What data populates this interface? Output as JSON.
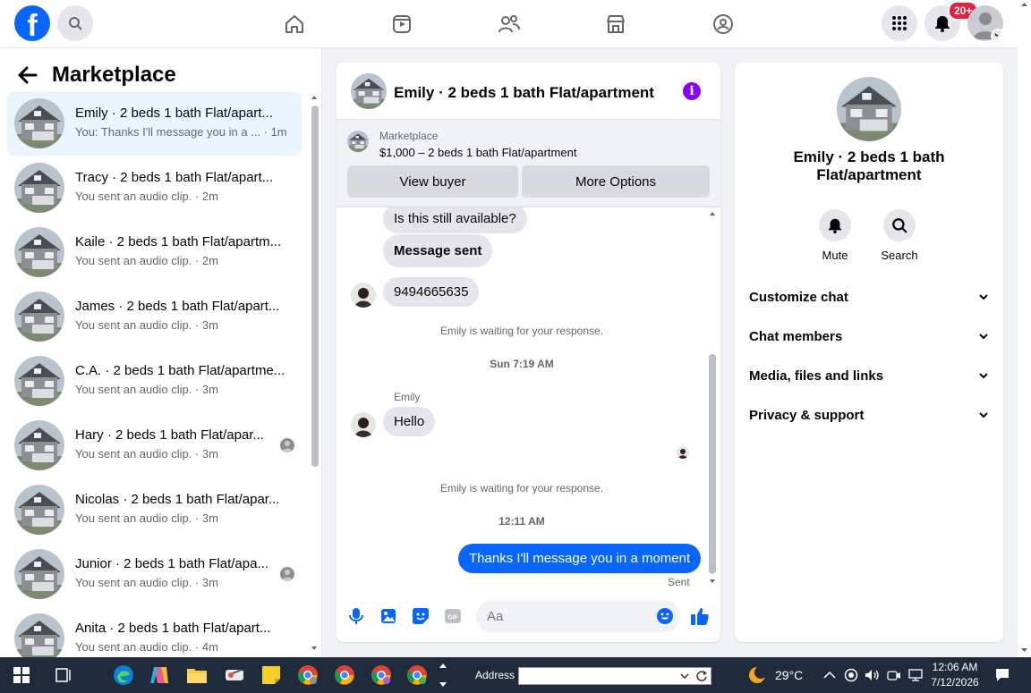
{
  "topbar": {
    "logo_letter": "f",
    "notifications_badge": "20+",
    "icons": [
      "facebook-logo",
      "search-icon",
      "home-icon",
      "video-icon",
      "friends-icon",
      "marketplace-icon",
      "groups-icon",
      "menu-grid-icon",
      "bell-icon",
      "profile-avatar"
    ]
  },
  "left": {
    "title": "Marketplace",
    "conversations": [
      {
        "name": "Emily · 2 beds 1 bath Flat/apart...",
        "preview": "You: Thanks I'll message you in a ...",
        "time": "· 1m",
        "active": true
      },
      {
        "name": "Tracy · 2 beds 1 bath Flat/apart...",
        "preview": "You sent an audio clip.",
        "time": "· 2m"
      },
      {
        "name": "Kaile · 2 beds 1 bath Flat/apartm...",
        "preview": "You sent an audio clip.",
        "time": "· 2m"
      },
      {
        "name": "James · 2 beds 1 bath Flat/apart...",
        "preview": "You sent an audio clip.",
        "time": "· 3m"
      },
      {
        "name": "C.A. · 2 beds 1 bath Flat/apartme...",
        "preview": "You sent an audio clip.",
        "time": "· 3m"
      },
      {
        "name": "Hary · 2 beds 1 bath Flat/apar...",
        "preview": "You sent an audio clip.",
        "time": "· 3m",
        "seen_avatar": true
      },
      {
        "name": "Nicolas · 2 beds 1 bath Flat/apar...",
        "preview": "You sent an audio clip.",
        "time": "· 3m"
      },
      {
        "name": "Junior · 2 beds 1 bath Flat/apa...",
        "preview": "You sent an audio clip.",
        "time": "· 3m",
        "seen_avatar": true
      },
      {
        "name": "Anita · 2 beds 1 bath Flat/apart...",
        "preview": "You sent an audio clip.",
        "time": "· 4m"
      }
    ]
  },
  "chat": {
    "title": "Emily · 2 beds 1 bath Flat/apartment",
    "listing_label": "Marketplace",
    "listing_price": "$1,000 – 2 beds 1 bath Flat/apartment",
    "view_buyer": "View buyer",
    "more_options": "More Options",
    "msg1": "Is this still available?",
    "msg2": "Message sent",
    "msg3": "9494665635",
    "waiting1": "Emily is waiting for your response.",
    "stamp1": "Sun 7:19 AM",
    "sender": "Emily",
    "msg4": "Hello",
    "waiting2": "Emily is waiting for your response.",
    "stamp2": "12:11 AM",
    "msg5": "Thanks I'll message you in a moment",
    "status": "Sent",
    "input_placeholder": "Aa"
  },
  "right": {
    "name": "Emily · 2 beds 1 bath Flat/apartment",
    "mute": "Mute",
    "search": "Search",
    "sections": [
      "Customize chat",
      "Chat members",
      "Media, files and links",
      "Privacy & support"
    ]
  },
  "taskbar": {
    "address_label": "Address",
    "temperature": "29°C",
    "time": "12:06 AM",
    "date": "7/12/2026"
  },
  "colors": {
    "brand": "#0866ff",
    "badge": "#e41e3f",
    "info": "#8a00ff"
  }
}
